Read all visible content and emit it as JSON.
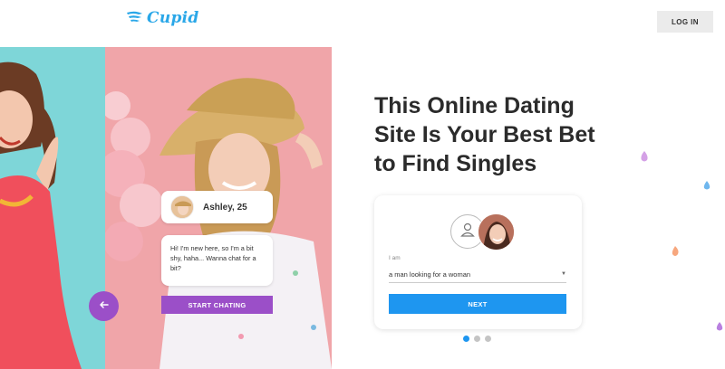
{
  "header": {
    "logo_text": "Cupid",
    "login_label": "LOG IN"
  },
  "hero": {
    "profile_name": "Ashley, 25",
    "chat_message": "Hi! I'm new here, so I'm a bit shy, haha... Wanna chat for a bit?",
    "chat_button_label": "START CHATING"
  },
  "main": {
    "headline_line1": "This Online Dating",
    "headline_line2": "Site Is Your Best Bet",
    "headline_line3": "to Find Singles"
  },
  "form": {
    "field_label": "I am",
    "select_value": "a man looking for a woman",
    "next_label": "NEXT"
  },
  "pagination": {
    "total": 3,
    "active_index": 0
  },
  "colors": {
    "brand_blue": "#2aa7e8",
    "accent_purple": "#9b4fc8",
    "button_blue": "#1e96f0",
    "panel_teal": "#7ed6d8",
    "panel_pink": "#f0a5a9"
  },
  "icons": {
    "logo": "wing-icon",
    "prev": "arrow-left-icon",
    "user": "user-icon",
    "caret": "caret-down-icon"
  }
}
